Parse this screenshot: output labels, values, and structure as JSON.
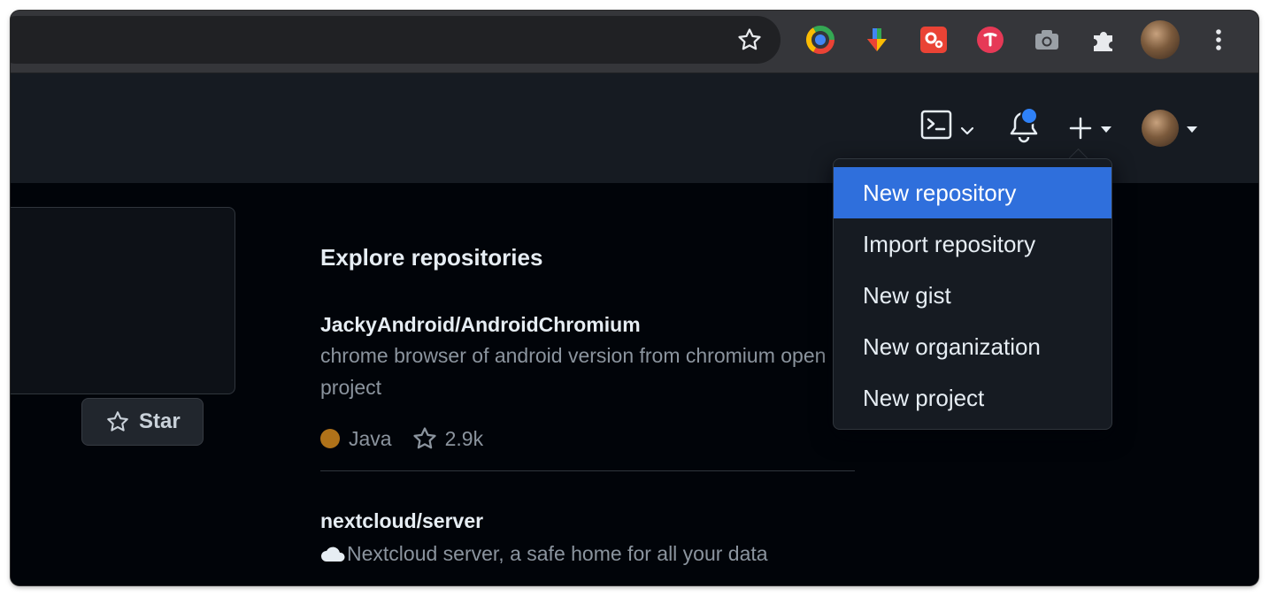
{
  "browser": {
    "icons": [
      "bookmark-star-icon",
      "chrome-extension-icon",
      "download-arrow-icon",
      "red-gear-extension-icon",
      "pink-extension-icon",
      "camera-extension-icon",
      "puzzle-extensions-icon",
      "profile-avatar",
      "kebab-menu-icon"
    ]
  },
  "header": {
    "icons": [
      "command-palette-icon",
      "notifications-bell-icon",
      "create-new-plus-icon",
      "user-avatar"
    ],
    "notification_dot_color": "#2f81f7"
  },
  "dropdown": {
    "items": [
      {
        "label": "New repository",
        "active": true
      },
      {
        "label": "Import repository",
        "active": false
      },
      {
        "label": "New gist",
        "active": false
      },
      {
        "label": "New organization",
        "active": false
      },
      {
        "label": "New project",
        "active": false
      }
    ],
    "active_color": "#2f6fdc"
  },
  "left_card": {
    "star_label": "Star"
  },
  "explore": {
    "title": "Explore repositories",
    "repos": [
      {
        "name": "JackyAndroid/AndroidChromium",
        "description": "chrome browser of android version from chromium open project",
        "language": "Java",
        "language_color": "#b07219",
        "stars": "2.9k"
      },
      {
        "name": "nextcloud/server",
        "description": "Nextcloud server, a safe home for all your data"
      }
    ]
  }
}
